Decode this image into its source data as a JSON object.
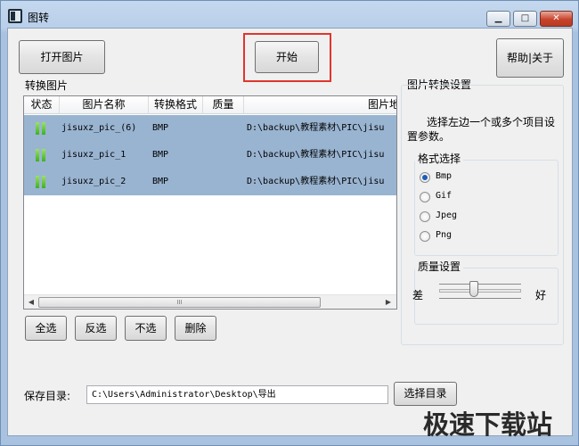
{
  "window": {
    "title": "图转"
  },
  "toolbar": {
    "open_label": "打开图片",
    "start_label": "开始",
    "help_label": "帮助|关于"
  },
  "list": {
    "title": "转换图片",
    "columns": [
      "状态",
      "图片名称",
      "转换格式",
      "质量",
      "图片地址"
    ],
    "rows": [
      {
        "name": "jisuxz_pic_(6)",
        "format": "BMP",
        "quality": "",
        "path": "D:\\backup\\教程素材\\PIC\\jisu"
      },
      {
        "name": "jisuxz_pic_1",
        "format": "BMP",
        "quality": "",
        "path": "D:\\backup\\教程素材\\PIC\\jisu"
      },
      {
        "name": "jisuxz_pic_2",
        "format": "BMP",
        "quality": "",
        "path": "D:\\backup\\教程素材\\PIC\\jisu"
      }
    ],
    "scroll_thumb_glyph": "III"
  },
  "selection": {
    "all_label": "全选",
    "invert_label": "反选",
    "none_label": "不选",
    "delete_label": "删除"
  },
  "settings": {
    "title": "图片转换设置",
    "hint": "选择左边一个或多个项目设置参数。",
    "format_group": "格式选择",
    "formats": [
      "Bmp",
      "Gif",
      "Jpeg",
      "Png"
    ],
    "selected_format": "Bmp",
    "quality_group": "质量设置",
    "quality_low": "差",
    "quality_high": "好",
    "quality_level": 0.42
  },
  "save": {
    "label": "保存目录:",
    "path": "C:\\Users\\Administrator\\Desktop\\导出",
    "choose_label": "选择目录"
  },
  "watermark": "极速下载站",
  "colors": {
    "row_selected": "#99b4d1",
    "highlight_box": "#e0352d",
    "close_button": "#c7432c",
    "status_green": "#3bb21d"
  },
  "icons": {
    "status": "status-ready-icon",
    "app": "app-icon"
  }
}
